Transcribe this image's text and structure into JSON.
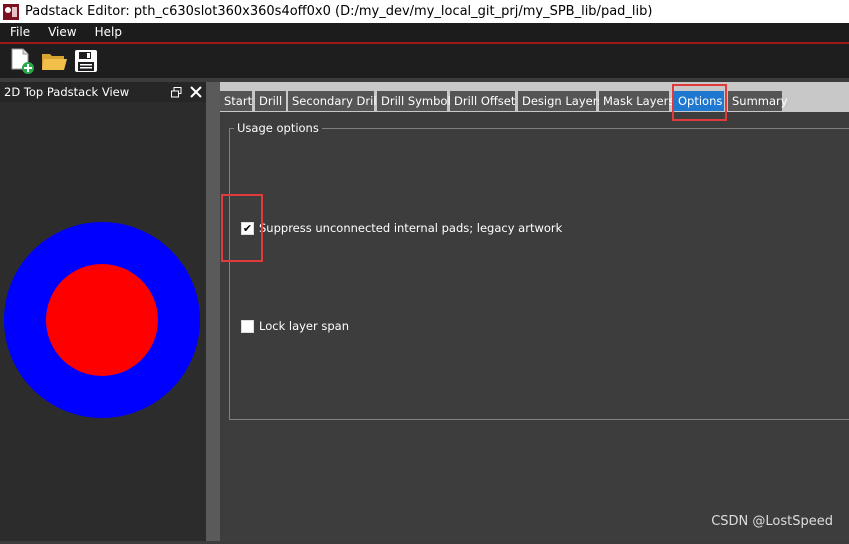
{
  "window": {
    "title": "Padstack Editor: pth_c630slot360x360s4off0x0  (D:/my_dev/my_local_git_prj/my_SPB_lib/pad_lib)"
  },
  "menu": {
    "items": [
      "File",
      "View",
      "Help"
    ]
  },
  "toolbar": {
    "buttons": [
      "new-file-icon",
      "open-folder-icon",
      "save-icon"
    ]
  },
  "left_panel": {
    "title": "2D Top Padstack View",
    "pad": {
      "outer_color": "#0000ff",
      "inner_color": "#ff0000"
    }
  },
  "tabs": {
    "items": [
      "Start",
      "Drill",
      "Secondary Drill",
      "Drill Symbol",
      "Drill Offset",
      "Design Layers",
      "Mask Layers",
      "Options",
      "Summary"
    ],
    "active": "Options"
  },
  "options": {
    "group_title": "Usage options",
    "suppress_label": "Suppress unconnected internal pads; legacy artwork",
    "suppress_checked": true,
    "lock_label": "Lock layer span",
    "lock_checked": false
  },
  "watermark": "CSDN @LostSpeed",
  "colors": {
    "accent": "#1e78d0",
    "highlight": "#e03a3a"
  }
}
